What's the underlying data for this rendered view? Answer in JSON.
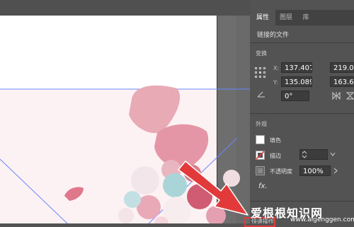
{
  "panel": {
    "tabs": [
      "属性",
      "图层",
      "库"
    ],
    "linked_file": "链接的文件",
    "transform_title": "变换",
    "x_label": "X:",
    "x_value": "137.407",
    "y_label": "Y:",
    "y_value": "135.089",
    "width_label": "宽:",
    "width_value": "219.07",
    "height_label": "高:",
    "height_value": "163.68",
    "angle_value": "0°",
    "appearance_title": "外观",
    "fill_label": "填色",
    "stroke_label": "描边",
    "opacity_label": "不透明度",
    "opacity_value": "100%",
    "fx_label": "fx.",
    "quick_actions_label": "快速操作"
  },
  "watermark": {
    "text": "爱根根知识网",
    "url": "www.aigenggen.com"
  },
  "colors": {
    "accent_guide": "#6b86ff",
    "highlight_red": "#e23a3a",
    "panel_bg": "#535353"
  }
}
